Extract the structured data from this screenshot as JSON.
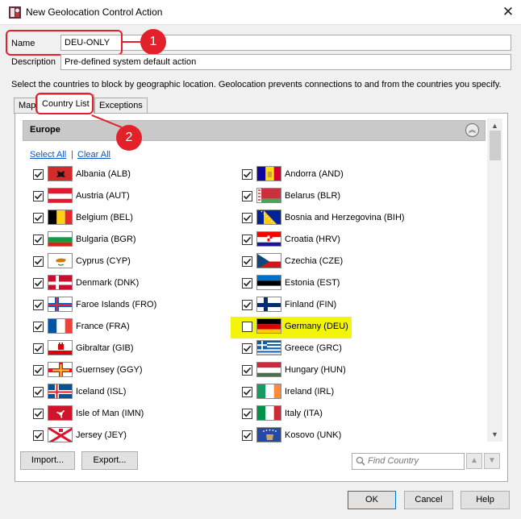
{
  "window": {
    "title": "New Geolocation Control Action",
    "close_glyph": "✕"
  },
  "form": {
    "name_label": "Name",
    "name_value": "DEU-ONLY",
    "description_label": "Description",
    "description_value": "Pre-defined system default action"
  },
  "instructions": "Select the countries to block by geographic location. Geolocation prevents connections to and from the countries you specify.",
  "tabs": [
    {
      "label": "Map",
      "active": false
    },
    {
      "label": "Country List",
      "active": true
    },
    {
      "label": "Exceptions",
      "active": false
    }
  ],
  "callouts": [
    "1",
    "2"
  ],
  "region": {
    "title": "Europe",
    "collapse_icon": "double-chevron-up-icon",
    "select_all": "Select All",
    "separator": "|",
    "clear_all": "Clear All"
  },
  "countries_left": [
    {
      "name": "Albania (ALB)",
      "checked": true
    },
    {
      "name": "Austria (AUT)",
      "checked": true
    },
    {
      "name": "Belgium (BEL)",
      "checked": true
    },
    {
      "name": "Bulgaria (BGR)",
      "checked": true
    },
    {
      "name": "Cyprus (CYP)",
      "checked": true
    },
    {
      "name": "Denmark (DNK)",
      "checked": true
    },
    {
      "name": "Faroe Islands (FRO)",
      "checked": true
    },
    {
      "name": "France (FRA)",
      "checked": true
    },
    {
      "name": "Gibraltar (GIB)",
      "checked": true
    },
    {
      "name": "Guernsey (GGY)",
      "checked": true
    },
    {
      "name": "Iceland (ISL)",
      "checked": true
    },
    {
      "name": "Isle of Man (IMN)",
      "checked": true
    },
    {
      "name": "Jersey (JEY)",
      "checked": true
    }
  ],
  "countries_right": [
    {
      "name": "Andorra (AND)",
      "checked": true
    },
    {
      "name": "Belarus (BLR)",
      "checked": true
    },
    {
      "name": "Bosnia and Herzegovina (BIH)",
      "checked": true
    },
    {
      "name": "Croatia (HRV)",
      "checked": true
    },
    {
      "name": "Czechia (CZE)",
      "checked": true
    },
    {
      "name": "Estonia (EST)",
      "checked": true
    },
    {
      "name": "Finland (FIN)",
      "checked": true
    },
    {
      "name": "Germany (DEU)",
      "checked": false
    },
    {
      "name": "Greece (GRC)",
      "checked": true
    },
    {
      "name": "Hungary (HUN)",
      "checked": true
    },
    {
      "name": "Ireland (IRL)",
      "checked": true
    },
    {
      "name": "Italy (ITA)",
      "checked": true
    },
    {
      "name": "Kosovo (UNK)",
      "checked": true
    }
  ],
  "buttons": {
    "import": "Import...",
    "export": "Export...",
    "ok": "OK",
    "cancel": "Cancel",
    "help": "Help"
  },
  "search": {
    "placeholder": "Find Country",
    "icon": "search-icon"
  },
  "colors": {
    "callout": "#e3212b",
    "highlight": "#f2f50a",
    "link": "#0b54c8",
    "check": "#1d1d1d"
  }
}
